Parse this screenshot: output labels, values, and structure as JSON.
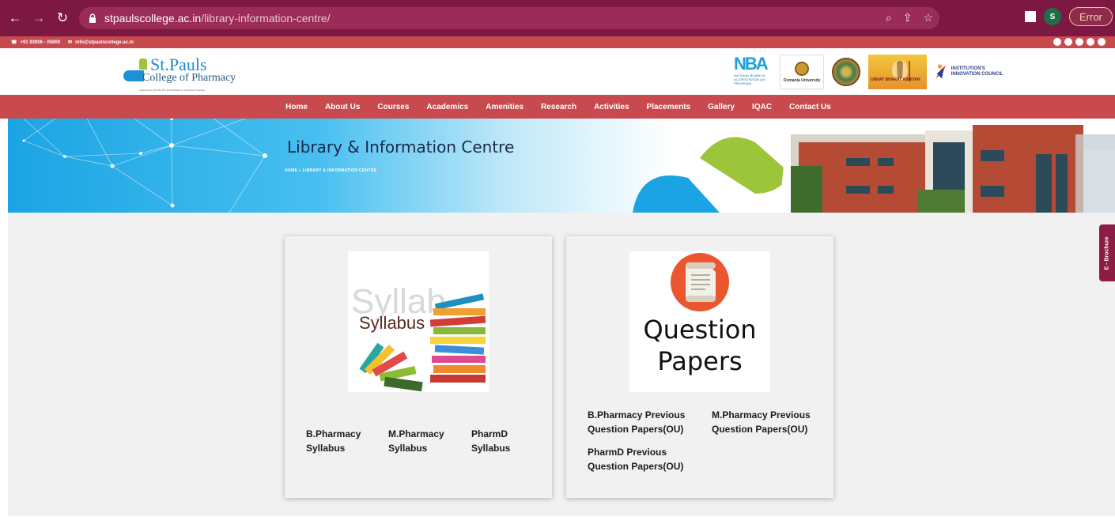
{
  "browser": {
    "url_domain": "stpaulscollege.ac.in",
    "url_path": "/library-information-centre/",
    "profile_initial": "S",
    "error_label": "Error"
  },
  "info_strip": {
    "phone": "+91 93906 - 05800",
    "email": "info@stpaulscollege.ac.in"
  },
  "logo": {
    "title": "St.Pauls",
    "subtitle": "College of Pharmacy",
    "fine_print": "(Approved by AICTE, PCI and Affiliated to Osmania University)"
  },
  "accreditation": {
    "nba_letters": "NBA",
    "nba_text": "NATIONAL BOARD of ACCREDITATION (UG PROGRAM)",
    "ou_text": "Osmania University",
    "uba_text": "UNNAT BHARAT ABHIYAN",
    "iic_text": "INSTITUTION'S INNOVATION COUNCIL"
  },
  "nav": [
    "Home",
    "About Us",
    "Courses",
    "Academics",
    "Amenities",
    "Research",
    "Activities",
    "Placements",
    "Gallery",
    "IQAC",
    "Contact Us"
  ],
  "banner": {
    "title": "Library & Information Centre",
    "breadcrumb": "HOME » LIBRARY & INFORMATION CENTRE"
  },
  "cards": {
    "syllabus": {
      "image_word": "Syllabus",
      "image_bg_word": "Syllab",
      "links": [
        "B.Pharmacy Syllabus",
        "M.Pharmacy Syllabus",
        "PharmD Syllabus"
      ]
    },
    "question_papers": {
      "image_line1": "Question",
      "image_line2": "Papers",
      "links": [
        "B.Pharmacy Previous Question Papers(OU)",
        "M.Pharmacy Previous Question Papers(OU)",
        "PharmD Previous Question Papers(OU)"
      ]
    }
  },
  "brochure_label": "E - Brochure",
  "colors": {
    "browser_bar": "#7d1842",
    "nav_red": "#c94a4e",
    "logo_blue": "#1c8bd0",
    "logo_green": "#9dc53b",
    "content_bg": "#f1f1f1",
    "brochure_tab": "#8d1d45"
  }
}
